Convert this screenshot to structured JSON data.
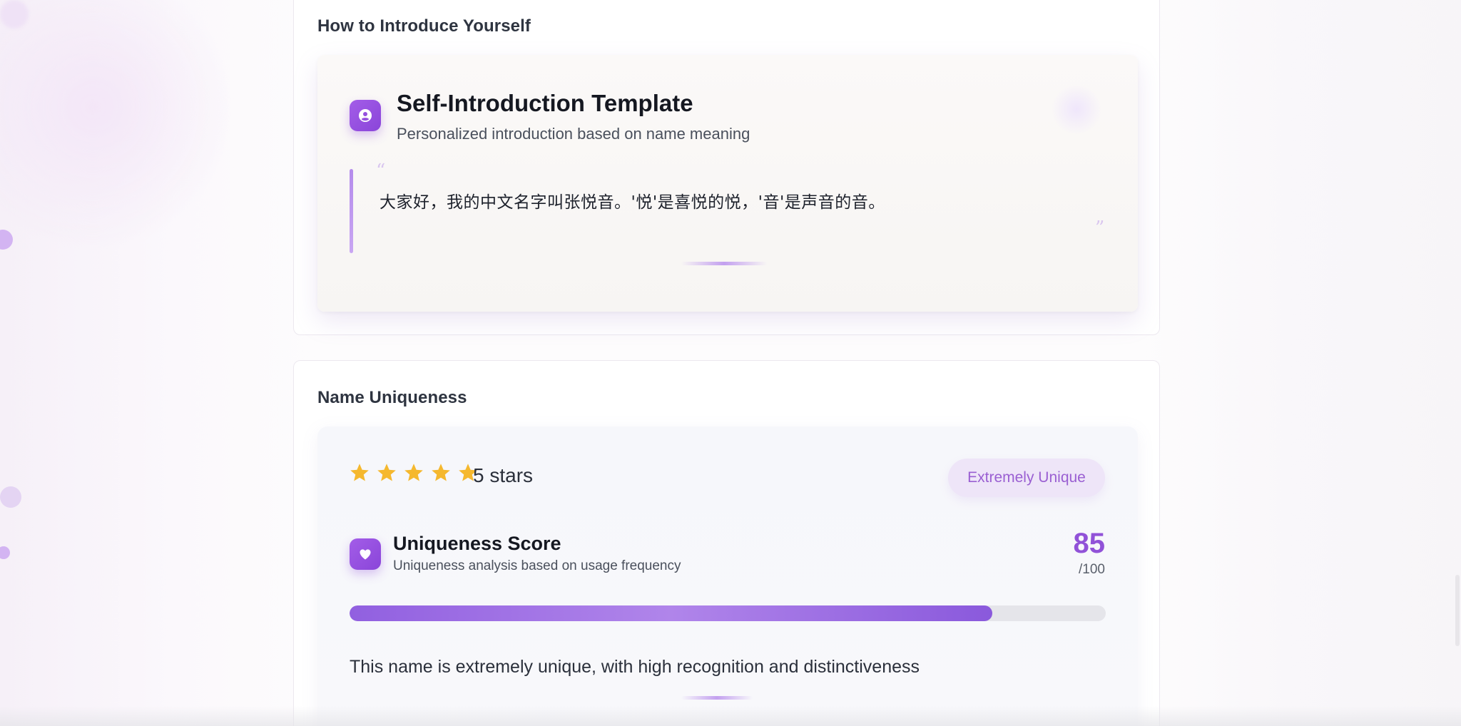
{
  "intro_section": {
    "title": "How to Introduce Yourself",
    "card": {
      "icon": "user-circle-icon",
      "heading": "Self-Introduction Template",
      "subtitle": "Personalized introduction based on name meaning",
      "quote_open": "“",
      "quote_text": "大家好，我的中文名字叫张悦音。'悦'是喜悦的悦，'音'是声音的音。",
      "quote_close": "”"
    }
  },
  "uniqueness_section": {
    "title": "Name Uniqueness",
    "rating": {
      "stars": 5,
      "max_stars": 5,
      "label": "5 stars",
      "star_color": "#f5b82e"
    },
    "badge": "Extremely Unique",
    "score_card": {
      "icon": "heart-icon",
      "heading": "Uniqueness Score",
      "subtitle": "Uniqueness analysis based on usage frequency",
      "score": "85",
      "max": "/100",
      "progress_fraction": 0.85
    },
    "description": "This name is extremely unique, with high recognition and distinctiveness"
  },
  "colors": {
    "accent": "#9152d8",
    "badge_bg": "#eee5f8",
    "progress_track": "#e5e5ea"
  }
}
